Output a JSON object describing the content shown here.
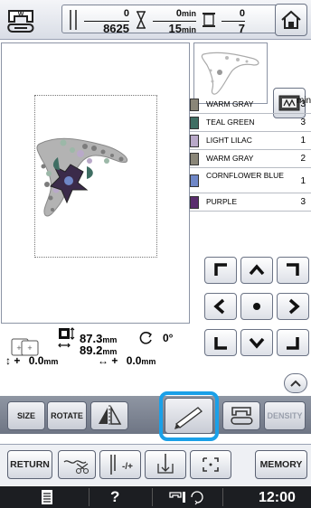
{
  "top_bar": {
    "machine_icon": "machine-w-icon",
    "stitch_count": {
      "current": "0",
      "total": "8625"
    },
    "time": {
      "current": "0",
      "current_unit": "min",
      "total": "15",
      "total_unit": "min"
    },
    "color_changes": {
      "current": "0",
      "total": "7"
    },
    "home_icon": "home-icon"
  },
  "color_list": {
    "minutes_header": "min",
    "items": [
      {
        "name": "WARM GRAY",
        "minutes": "3",
        "color": "#8a8678"
      },
      {
        "name": "TEAL GREEN",
        "minutes": "3",
        "color": "#3f6e63"
      },
      {
        "name": "LIGHT LILAC",
        "minutes": "1",
        "color": "#b9a9c9"
      },
      {
        "name": "WARM GRAY",
        "minutes": "2",
        "color": "#8a8678"
      },
      {
        "name": "CORNFLOWER BLUE",
        "minutes": "1",
        "color": "#6f87c7"
      },
      {
        "name": "PURPLE",
        "minutes": "3",
        "color": "#5a2d6e"
      }
    ]
  },
  "info": {
    "height_value": "87.3",
    "width_value": "89.2",
    "size_unit": "mm",
    "angle": "0°",
    "offset_y": "0.0",
    "offset_x": "0.0",
    "offset_unit": "mm",
    "offset_y_sign": "+",
    "offset_x_sign": "+"
  },
  "edit_row": {
    "size_label": "SIZE",
    "rotate_label": "ROTATE",
    "density_label": "DENSITY"
  },
  "bottom_row": {
    "return_label": "RETURN",
    "memory_label": "MEMORY"
  },
  "status_bar": {
    "help_label": "?",
    "clock": "12:00"
  },
  "colors": {
    "highlight": "#1aa0e8",
    "edit_bar": "#7a8190",
    "status_bar": "#1c1e22"
  }
}
